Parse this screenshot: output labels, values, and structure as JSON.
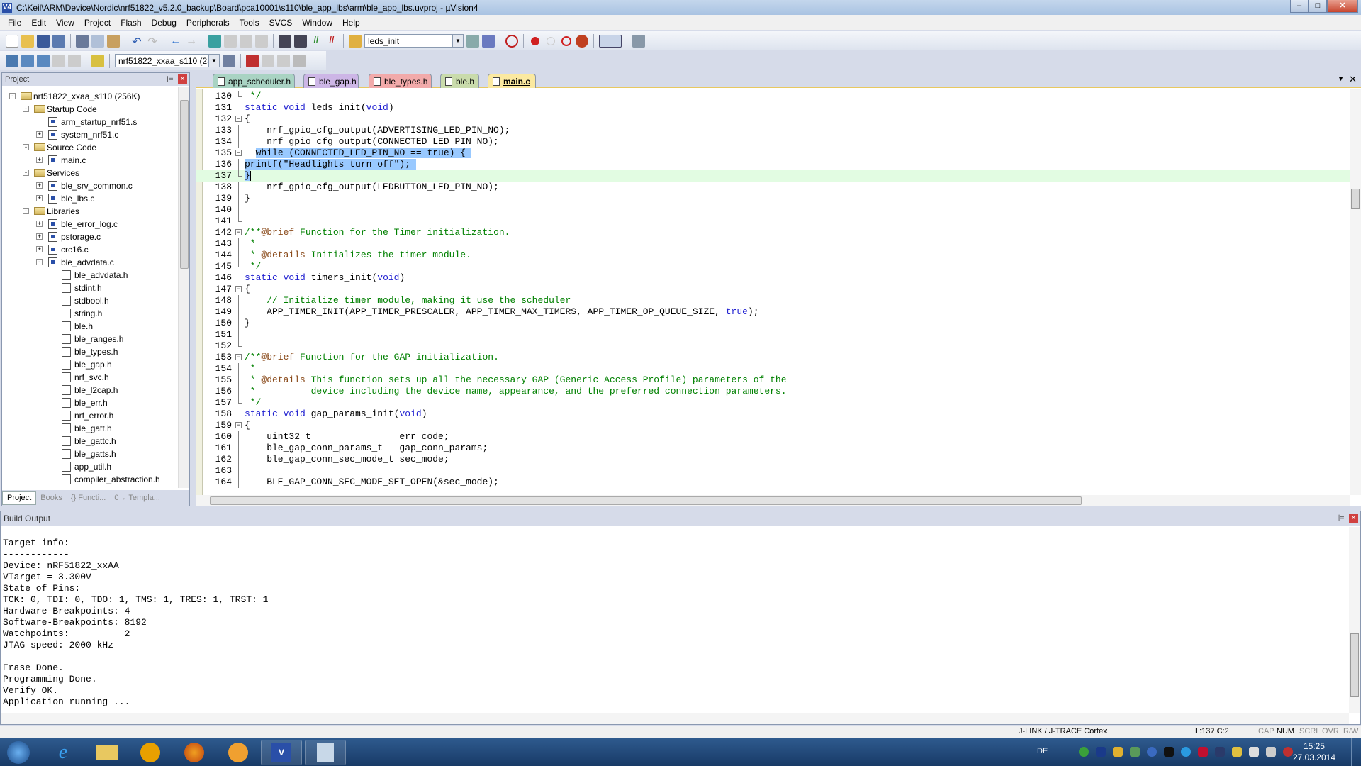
{
  "window": {
    "title": "C:\\Keil\\ARM\\Device\\Nordic\\nrf51822_v5.2.0_backup\\Board\\pca10001\\s110\\ble_app_lbs\\arm\\ble_app_lbs.uvproj - µVision4",
    "app_icon": "V4"
  },
  "menu": [
    "File",
    "Edit",
    "View",
    "Project",
    "Flash",
    "Debug",
    "Peripherals",
    "Tools",
    "SVCS",
    "Window",
    "Help"
  ],
  "toolbar": {
    "find_combo": "leds_init",
    "target_combo": "nrf51822_xxaa_s110 (256K)"
  },
  "project": {
    "title": "Project",
    "tree": [
      {
        "label": "nrf51822_xxaa_s110 (256K)",
        "level": 0,
        "exp": "-",
        "icon": "target"
      },
      {
        "label": "Startup Code",
        "level": 1,
        "exp": "-",
        "icon": "folder"
      },
      {
        "label": "arm_startup_nrf51.s",
        "level": 2,
        "exp": "",
        "icon": "src"
      },
      {
        "label": "system_nrf51.c",
        "level": 2,
        "exp": "+",
        "icon": "src"
      },
      {
        "label": "Source Code",
        "level": 1,
        "exp": "-",
        "icon": "folder"
      },
      {
        "label": "main.c",
        "level": 2,
        "exp": "+",
        "icon": "src"
      },
      {
        "label": "Services",
        "level": 1,
        "exp": "-",
        "icon": "folder"
      },
      {
        "label": "ble_srv_common.c",
        "level": 2,
        "exp": "+",
        "icon": "src"
      },
      {
        "label": "ble_lbs.c",
        "level": 2,
        "exp": "+",
        "icon": "src"
      },
      {
        "label": "Libraries",
        "level": 1,
        "exp": "-",
        "icon": "folder"
      },
      {
        "label": "ble_error_log.c",
        "level": 2,
        "exp": "+",
        "icon": "src"
      },
      {
        "label": "pstorage.c",
        "level": 2,
        "exp": "+",
        "icon": "src"
      },
      {
        "label": "crc16.c",
        "level": 2,
        "exp": "+",
        "icon": "src"
      },
      {
        "label": "ble_advdata.c",
        "level": 2,
        "exp": "-",
        "icon": "src"
      },
      {
        "label": "ble_advdata.h",
        "level": 3,
        "exp": "",
        "icon": "hdr"
      },
      {
        "label": "stdint.h",
        "level": 3,
        "exp": "",
        "icon": "hdr"
      },
      {
        "label": "stdbool.h",
        "level": 3,
        "exp": "",
        "icon": "hdr"
      },
      {
        "label": "string.h",
        "level": 3,
        "exp": "",
        "icon": "hdr"
      },
      {
        "label": "ble.h",
        "level": 3,
        "exp": "",
        "icon": "hdr"
      },
      {
        "label": "ble_ranges.h",
        "level": 3,
        "exp": "",
        "icon": "hdr"
      },
      {
        "label": "ble_types.h",
        "level": 3,
        "exp": "",
        "icon": "hdr"
      },
      {
        "label": "ble_gap.h",
        "level": 3,
        "exp": "",
        "icon": "hdr"
      },
      {
        "label": "nrf_svc.h",
        "level": 3,
        "exp": "",
        "icon": "hdr"
      },
      {
        "label": "ble_l2cap.h",
        "level": 3,
        "exp": "",
        "icon": "hdr"
      },
      {
        "label": "ble_err.h",
        "level": 3,
        "exp": "",
        "icon": "hdr"
      },
      {
        "label": "nrf_error.h",
        "level": 3,
        "exp": "",
        "icon": "hdr"
      },
      {
        "label": "ble_gatt.h",
        "level": 3,
        "exp": "",
        "icon": "hdr"
      },
      {
        "label": "ble_gattc.h",
        "level": 3,
        "exp": "",
        "icon": "hdr"
      },
      {
        "label": "ble_gatts.h",
        "level": 3,
        "exp": "",
        "icon": "hdr"
      },
      {
        "label": "app_util.h",
        "level": 3,
        "exp": "",
        "icon": "hdr"
      },
      {
        "label": "compiler_abstraction.h",
        "level": 3,
        "exp": "",
        "icon": "hdr"
      }
    ],
    "tabs": [
      {
        "label": "Project",
        "active": true
      },
      {
        "label": "Books"
      },
      {
        "label": "{} Functi..."
      },
      {
        "label": "0→ Templa..."
      }
    ]
  },
  "editor": {
    "tabs": [
      {
        "label": "app_scheduler.h",
        "color": "#a9d3c3"
      },
      {
        "label": "ble_gap.h",
        "color": "#cdb6e6"
      },
      {
        "label": "ble_types.h",
        "color": "#f2aaaa"
      },
      {
        "label": "ble.h",
        "color": "#c9dbab"
      },
      {
        "label": "main.c",
        "color": "#fbe9a0",
        "active": true
      }
    ],
    "lines": [
      {
        "n": "130",
        "f": "end",
        "t": [
          [
            "cm",
            " */"
          ]
        ]
      },
      {
        "n": "131",
        "t": [
          [
            "kw",
            "static void"
          ],
          [
            "",
            "leds_init("
          ],
          [
            "kw",
            "void"
          ],
          [
            "",
            ")"
          ]
        ]
      },
      {
        "n": "132",
        "f": "open",
        "t": [
          [
            "",
            "{"
          ]
        ]
      },
      {
        "n": "133",
        "f": "line",
        "t": [
          [
            "",
            "    nrf_gpio_cfg_output(ADVERTISING_LED_PIN_NO);"
          ]
        ]
      },
      {
        "n": "134",
        "f": "line",
        "t": [
          [
            "",
            "    nrf_gpio_cfg_output(CONNECTED_LED_PIN_NO);"
          ]
        ]
      },
      {
        "n": "135",
        "f": "open",
        "t": [
          [
            "",
            "  "
          ],
          [
            "sel",
            "while (CONNECTED_LED_PIN_NO == true) { "
          ]
        ]
      },
      {
        "n": "136",
        "f": "line",
        "t": [
          [
            "sel",
            "printf(\"Headlights turn off\"); "
          ]
        ]
      },
      {
        "n": "137",
        "f": "end",
        "cur": true,
        "t": [
          [
            "sel",
            "}"
          ]
        ]
      },
      {
        "n": "138",
        "f": "line",
        "t": [
          [
            "",
            "    nrf_gpio_cfg_output(LEDBUTTON_LED_PIN_NO);"
          ]
        ]
      },
      {
        "n": "139",
        "f": "line",
        "t": [
          [
            "",
            "}"
          ]
        ]
      },
      {
        "n": "140",
        "f": "line",
        "t": []
      },
      {
        "n": "141",
        "f": "end",
        "t": []
      },
      {
        "n": "142",
        "f": "open",
        "t": [
          [
            "cm",
            "/**"
          ],
          [
            "tag",
            "@brief"
          ],
          [
            "cm",
            " Function for the Timer initialization."
          ]
        ]
      },
      {
        "n": "143",
        "f": "line",
        "t": [
          [
            "cm",
            " *"
          ]
        ]
      },
      {
        "n": "144",
        "f": "line",
        "t": [
          [
            "cm",
            " * "
          ],
          [
            "tag",
            "@details"
          ],
          [
            "cm",
            " Initializes the timer module."
          ]
        ]
      },
      {
        "n": "145",
        "f": "end",
        "t": [
          [
            "cm",
            " */"
          ]
        ]
      },
      {
        "n": "146",
        "t": [
          [
            "kw",
            "static void"
          ],
          [
            "",
            "timers_init("
          ],
          [
            "kw",
            "void"
          ],
          [
            "",
            ")"
          ]
        ]
      },
      {
        "n": "147",
        "f": "open",
        "t": [
          [
            "",
            "{"
          ]
        ]
      },
      {
        "n": "148",
        "f": "line",
        "t": [
          [
            "",
            "    "
          ],
          [
            "cm",
            "// Initialize timer module, making it use the scheduler"
          ]
        ]
      },
      {
        "n": "149",
        "f": "line",
        "t": [
          [
            "",
            "    APP_TIMER_INIT(APP_TIMER_PRESCALER, APP_TIMER_MAX_TIMERS, APP_TIMER_OP_QUEUE_SIZE, "
          ],
          [
            "kw",
            "true"
          ],
          [
            "",
            ");"
          ]
        ]
      },
      {
        "n": "150",
        "f": "line",
        "t": [
          [
            "",
            "}"
          ]
        ]
      },
      {
        "n": "151",
        "f": "line",
        "t": []
      },
      {
        "n": "152",
        "f": "end",
        "t": []
      },
      {
        "n": "153",
        "f": "open",
        "t": [
          [
            "cm",
            "/**"
          ],
          [
            "tag",
            "@brief"
          ],
          [
            "cm",
            " Function for the GAP initialization."
          ]
        ]
      },
      {
        "n": "154",
        "f": "line",
        "t": [
          [
            "cm",
            " *"
          ]
        ]
      },
      {
        "n": "155",
        "f": "line",
        "t": [
          [
            "cm",
            " * "
          ],
          [
            "tag",
            "@details"
          ],
          [
            "cm",
            " This function sets up all the necessary GAP (Generic Access Profile) parameters of the"
          ]
        ]
      },
      {
        "n": "156",
        "f": "line",
        "t": [
          [
            "cm",
            " *          device including the device name, appearance, and the preferred connection parameters."
          ]
        ]
      },
      {
        "n": "157",
        "f": "end",
        "t": [
          [
            "cm",
            " */"
          ]
        ]
      },
      {
        "n": "158",
        "t": [
          [
            "kw",
            "static void"
          ],
          [
            "",
            "gap_params_init("
          ],
          [
            "kw",
            "void"
          ],
          [
            "",
            ")"
          ]
        ]
      },
      {
        "n": "159",
        "f": "open",
        "t": [
          [
            "",
            "{"
          ]
        ]
      },
      {
        "n": "160",
        "f": "line",
        "t": [
          [
            "",
            "    uint32_t                err_code;"
          ]
        ]
      },
      {
        "n": "161",
        "f": "line",
        "t": [
          [
            "",
            "    ble_gap_conn_params_t   gap_conn_params;"
          ]
        ]
      },
      {
        "n": "162",
        "f": "line",
        "t": [
          [
            "",
            "    ble_gap_conn_sec_mode_t sec_mode;"
          ]
        ]
      },
      {
        "n": "163",
        "f": "line",
        "t": []
      },
      {
        "n": "164",
        "f": "line",
        "t": [
          [
            "",
            "    BLE_GAP_CONN_SEC_MODE_SET_OPEN(&sec_mode);"
          ]
        ]
      }
    ]
  },
  "output": {
    "title": "Build Output",
    "text": "Target info:\n------------\nDevice: nRF51822_xxAA\nVTarget = 3.300V\nState of Pins:\nTCK: 0, TDI: 0, TDO: 1, TMS: 1, TRES: 1, TRST: 1\nHardware-Breakpoints: 4\nSoftware-Breakpoints: 8192\nWatchpoints:          2\nJTAG speed: 2000 kHz\n\nErase Done.\nProgramming Done.\nVerify OK.\nApplication running ..."
  },
  "status": {
    "debugger": "J-LINK / J-TRACE Cortex",
    "position": "L:137 C:2",
    "cap": "CAP",
    "num": "NUM",
    "scrl": "SCRL",
    "ovr": "OVR",
    "rw": "R/W"
  },
  "taskbar": {
    "lang": "DE",
    "time": "15:25",
    "date": "27.03.2014"
  }
}
